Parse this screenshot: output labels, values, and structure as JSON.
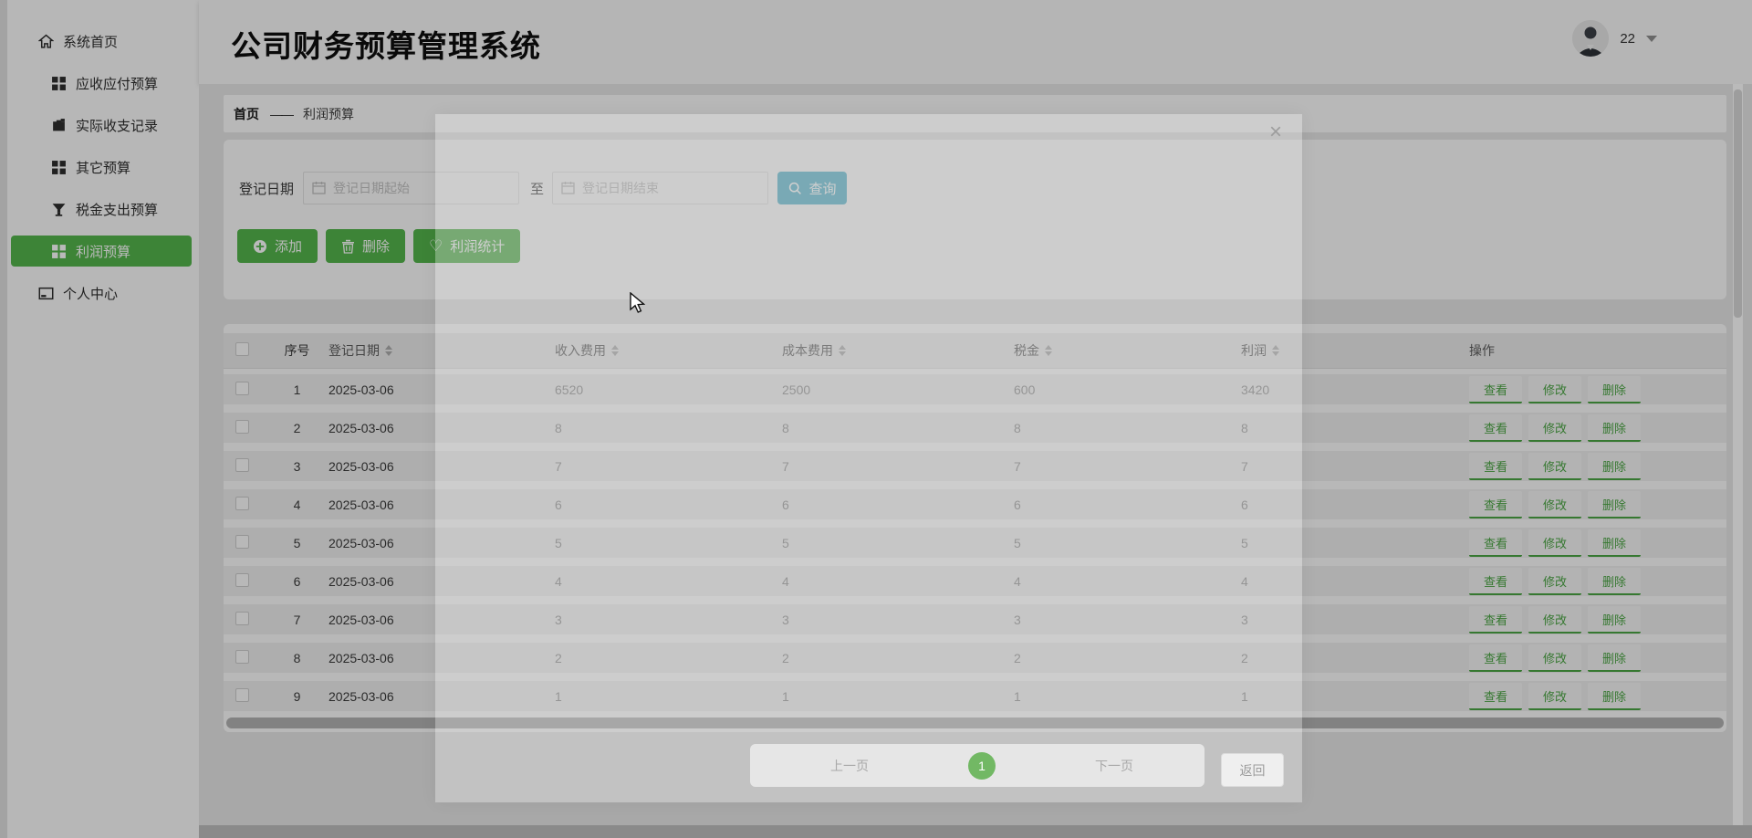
{
  "app": {
    "title": "公司财务预算管理系统",
    "user_name": "22"
  },
  "sidebar": {
    "items": [
      {
        "label": "系统首页",
        "icon": "home-icon",
        "active": false
      },
      {
        "label": "应收应付预算",
        "icon": "grid-icon",
        "active": false
      },
      {
        "label": "实际收支记录",
        "icon": "briefcase-icon",
        "active": false
      },
      {
        "label": "其它预算",
        "icon": "grid-icon",
        "active": false
      },
      {
        "label": "税金支出预算",
        "icon": "funnel-icon",
        "active": false
      },
      {
        "label": "利润预算",
        "icon": "grid-icon",
        "active": true
      },
      {
        "label": "个人中心",
        "icon": "card-icon",
        "active": false
      }
    ]
  },
  "breadcrumb": {
    "home": "首页",
    "separator": "——",
    "current": "利润预算"
  },
  "filters": {
    "label": "登记日期",
    "start_placeholder": "登记日期起始",
    "to": "至",
    "end_placeholder": "登记日期结束",
    "search_label": "查询"
  },
  "toolbar": {
    "add_label": "添加",
    "delete_label": "删除",
    "stats_label": "利润统计",
    "stats_icon": "♡"
  },
  "table": {
    "headers": [
      {
        "label": "序号"
      },
      {
        "label": "登记日期"
      },
      {
        "label": "收入费用"
      },
      {
        "label": "成本费用"
      },
      {
        "label": "税金"
      },
      {
        "label": "利润"
      },
      {
        "label": "操作"
      }
    ],
    "row_actions": [
      "查看",
      "修改",
      "删除"
    ],
    "rows": [
      {
        "index": "1",
        "date": "2025-03-06",
        "income": "6520",
        "cost": "2500",
        "tax": "600",
        "profit": "3420"
      },
      {
        "index": "2",
        "date": "2025-03-06",
        "income": "8",
        "cost": "8",
        "tax": "8",
        "profit": "8"
      },
      {
        "index": "3",
        "date": "2025-03-06",
        "income": "7",
        "cost": "7",
        "tax": "7",
        "profit": "7"
      },
      {
        "index": "4",
        "date": "2025-03-06",
        "income": "6",
        "cost": "6",
        "tax": "6",
        "profit": "6"
      },
      {
        "index": "5",
        "date": "2025-03-06",
        "income": "5",
        "cost": "5",
        "tax": "5",
        "profit": "5"
      },
      {
        "index": "6",
        "date": "2025-03-06",
        "income": "4",
        "cost": "4",
        "tax": "4",
        "profit": "4"
      },
      {
        "index": "7",
        "date": "2025-03-06",
        "income": "3",
        "cost": "3",
        "tax": "3",
        "profit": "3"
      },
      {
        "index": "8",
        "date": "2025-03-06",
        "income": "2",
        "cost": "2",
        "tax": "2",
        "profit": "2"
      },
      {
        "index": "9",
        "date": "2025-03-06",
        "income": "1",
        "cost": "1",
        "tax": "1",
        "profit": "1"
      }
    ]
  },
  "pagination": {
    "prev": "上一页",
    "current": "1",
    "next": "下一页",
    "back": "返回"
  },
  "modal": {
    "close": "×"
  },
  "colors": {
    "primary_green": "#54b64c",
    "query_teal": "#58b7cd",
    "page_green": "#72b864"
  }
}
